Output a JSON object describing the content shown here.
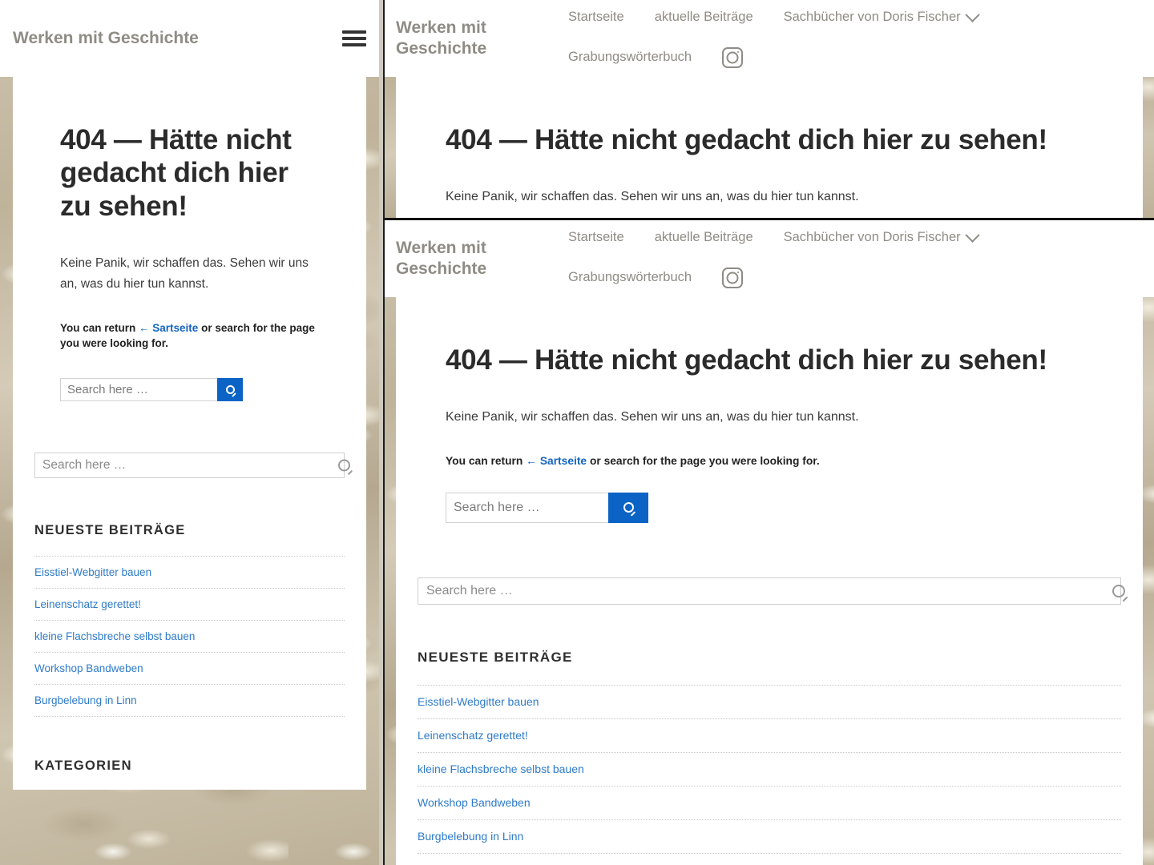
{
  "site": {
    "title": "Werken mit Geschichte"
  },
  "nav": {
    "items": [
      {
        "label": "Startseite",
        "has_dropdown": false
      },
      {
        "label": "aktuelle Beiträge",
        "has_dropdown": false
      },
      {
        "label": "Sachbücher von Doris Fischer",
        "has_dropdown": true
      },
      {
        "label": "Grabungswörterbuch",
        "has_dropdown": false
      }
    ],
    "social": {
      "icon": "instagram-icon"
    },
    "mobile_toggle_icon": "hamburger-menu-icon"
  },
  "error_page": {
    "heading": "404 — Hätte nicht gedacht dich hier zu sehen!",
    "lead": "Keine Panik, wir schaffen das. Sehen wir uns an, was du hier tun kannst.",
    "return_prefix": "You can return",
    "return_link": "← Sartseite",
    "return_suffix": "or search for the page you were looking for."
  },
  "search": {
    "placeholder": "Search here …",
    "value": "",
    "button_icon": "search-icon",
    "button_color": "#0b63c5"
  },
  "widgets": {
    "recent_posts": {
      "title": "NEUESTE BEITRÄGE",
      "items": [
        "Eisstiel-Webgitter bauen",
        "Leinenschatz gerettet!",
        "kleine Flachsbreche selbst bauen",
        "Workshop Bandweben",
        "Burgbelebung in Linn"
      ]
    },
    "categories": {
      "title": "KATEGORIEN"
    }
  },
  "theme": {
    "link_color": "#2e7bc8",
    "accent_color": "#1464c0",
    "muted_text": "#8f8c85",
    "background": "#c6bba4"
  }
}
